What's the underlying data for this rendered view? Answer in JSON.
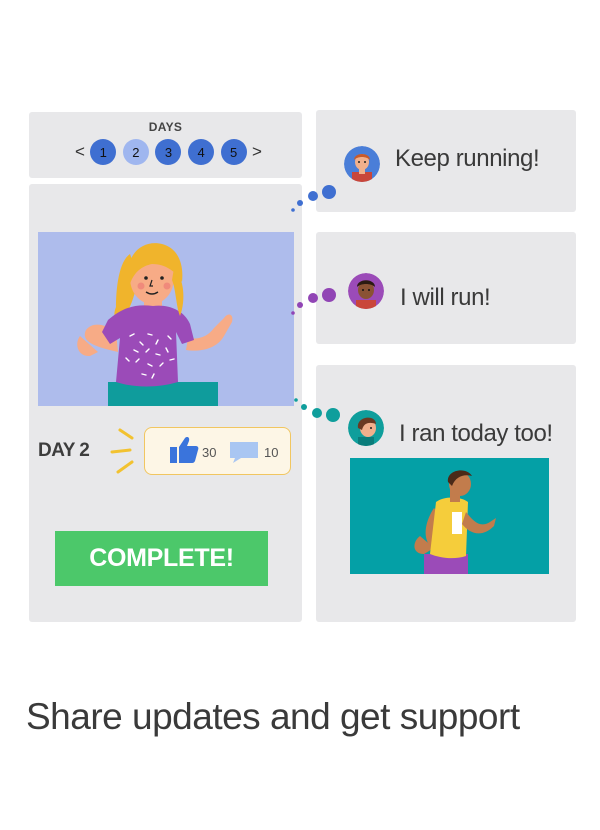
{
  "days": {
    "title": "DAYS",
    "prev_arrow": "<",
    "next_arrow": ">",
    "items": [
      "1",
      "2",
      "3",
      "4",
      "5"
    ],
    "selected": "2"
  },
  "post": {
    "day_label": "DAY 2",
    "likes": "30",
    "comments": "10",
    "complete_label": "COMPLETE!"
  },
  "chat": [
    {
      "text": "Keep running!"
    },
    {
      "text": "I will run!"
    },
    {
      "text": "I ran today too!"
    }
  ],
  "caption": "Share updates and get support",
  "colors": {
    "day_dot": "#3f6fd1",
    "day_dot_selected": "#9fb6ef",
    "complete_button": "#4cc86a",
    "like_icon": "#3a74dc",
    "dots_blue": "#3f6fd1",
    "dots_purple": "#9145b5",
    "dots_teal": "#0f9e9c"
  },
  "icons": [
    "thumbs-up-icon",
    "comment-icon",
    "chevron-left-icon",
    "chevron-right-icon"
  ]
}
